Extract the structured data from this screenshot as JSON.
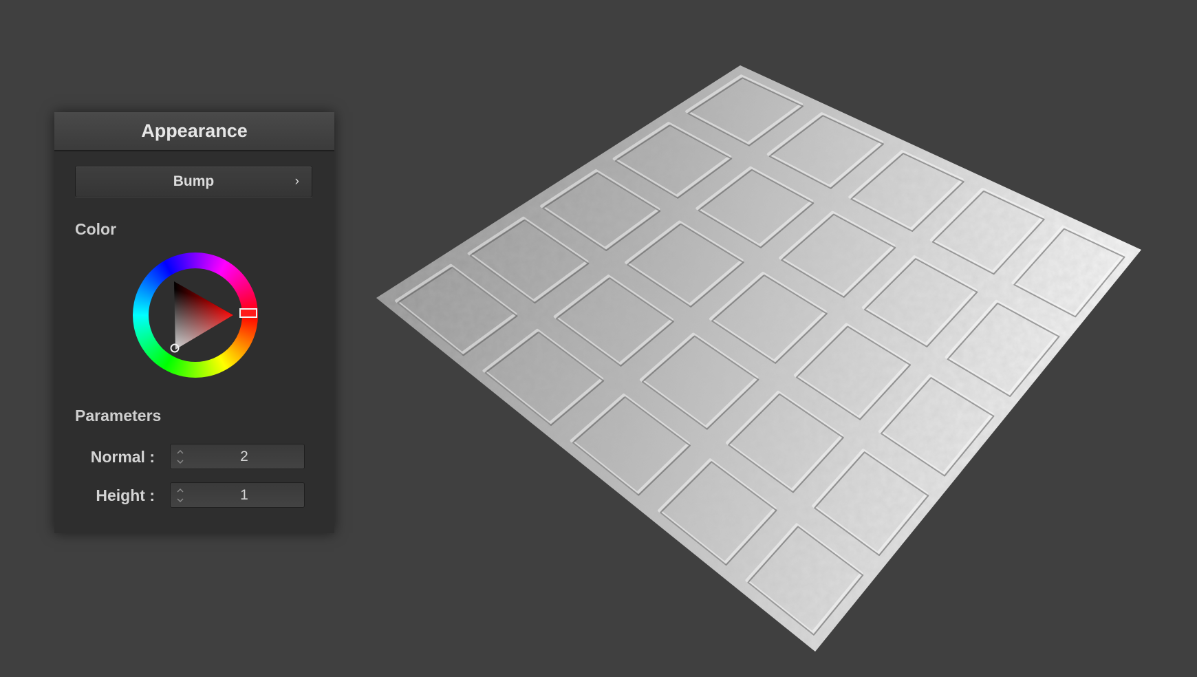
{
  "panel": {
    "title": "Appearance",
    "mode_button": {
      "label": "Bump",
      "chevron": "›",
      "icon": "chevron-right-icon"
    },
    "color_section": {
      "label": "Color",
      "hue_handle_color": "#ff1a1a",
      "selected_hue": "red"
    },
    "parameters_section": {
      "label": "Parameters",
      "fields": [
        {
          "label": "Normal :",
          "value": "2"
        },
        {
          "label": "Height :",
          "value": "1"
        }
      ]
    }
  },
  "colors": {
    "background": "#404040",
    "panel": "#2e2e2e",
    "header": "#424242",
    "text": "#dcdcdc"
  }
}
